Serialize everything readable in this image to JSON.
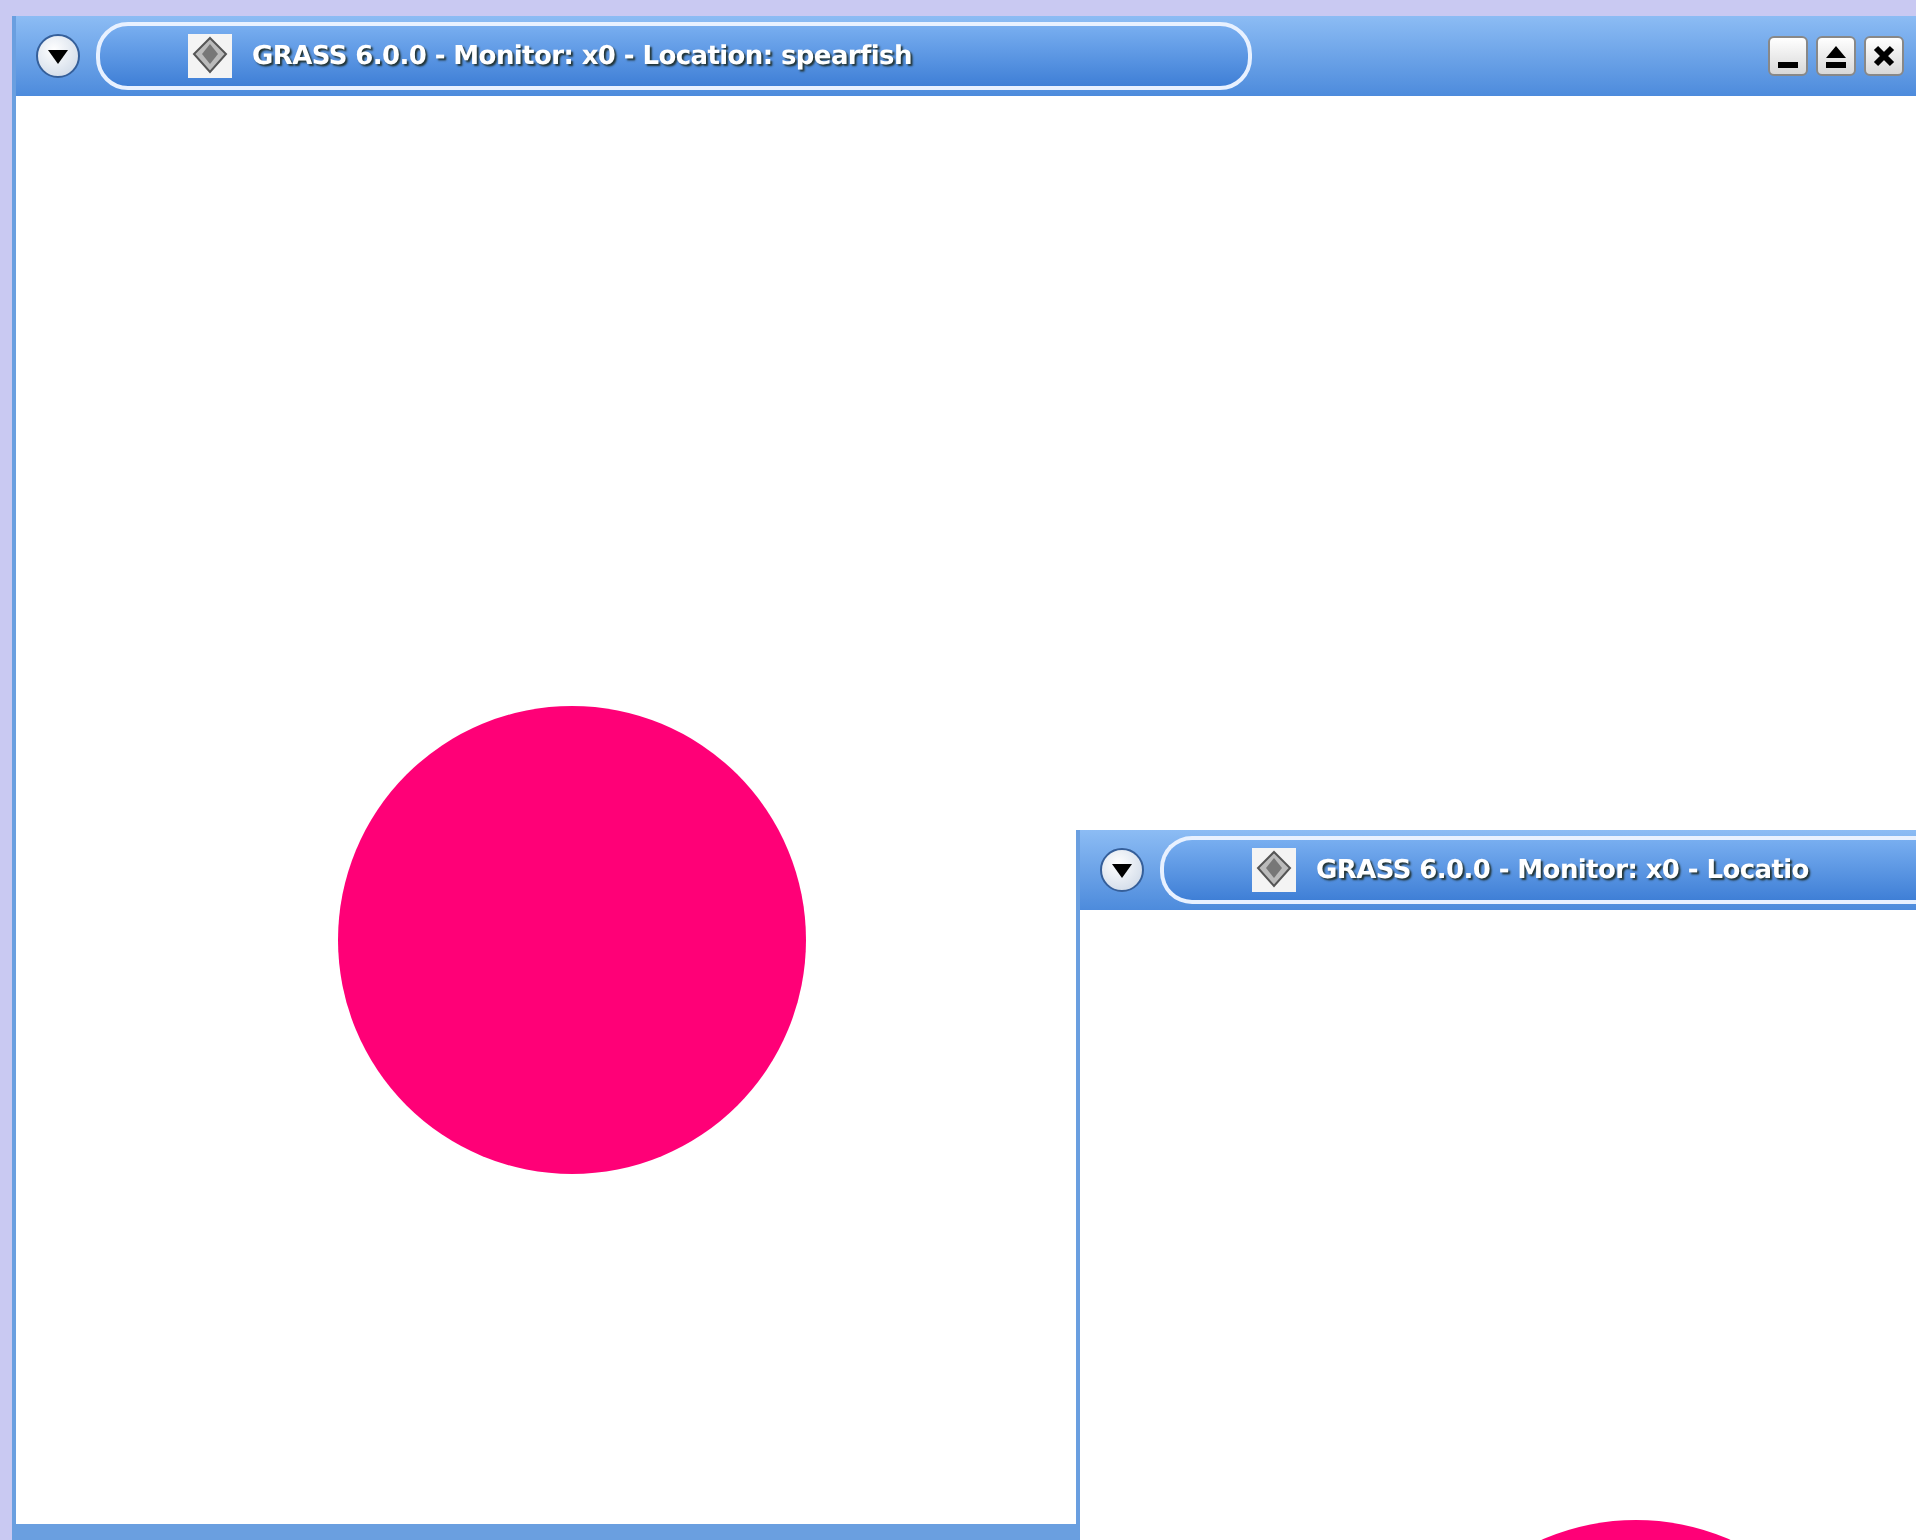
{
  "windows": [
    {
      "title": "GRASS 6.0.0 - Monitor: x0 - Location: spearfish",
      "controls_visible": true
    },
    {
      "title": "GRASS 6.0.0 - Monitor: x0 - Locatio",
      "controls_visible": false
    }
  ]
}
